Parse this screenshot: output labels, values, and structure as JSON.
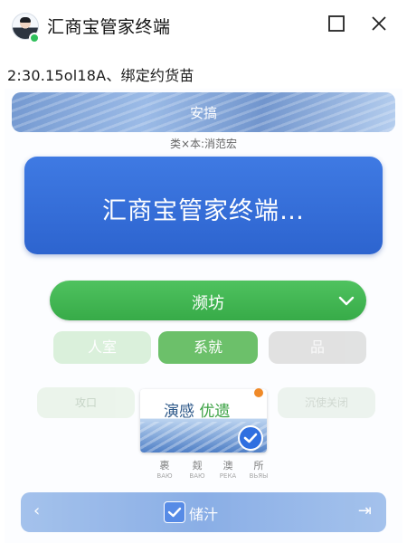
{
  "window": {
    "title": "汇商宝管家终端",
    "status_line": "2:30.15ol18A、绑定约货苗"
  },
  "screen": {
    "banner_label": "安搞",
    "subtitle": "类×本:消范宏",
    "hero_text": "汇商宝管家终端…",
    "select": {
      "selected": "濒坊",
      "icon": "chevron-down-icon"
    },
    "chips": [
      "人室",
      "系就",
      "品"
    ],
    "pills": {
      "left": "攻口",
      "right": "沉使关闭"
    },
    "card": {
      "title_a": "演感",
      "title_b": "优遗",
      "accent_color": "#3aa142"
    },
    "tiny_labels": [
      {
        "main": "裹",
        "sub": "ВАЮ"
      },
      {
        "main": "觌",
        "sub": "ВАЮ"
      },
      {
        "main": "澳",
        "sub": "РЕКА"
      },
      {
        "main": "所",
        "sub": "ВЬЯЫ"
      }
    ],
    "bottom_bar": {
      "label": "储汁"
    }
  },
  "colors": {
    "hero_blue": "#2f6fe0",
    "select_green": "#3aa142",
    "online_green": "#2fbf5a",
    "badge_orange": "#f08a28"
  }
}
